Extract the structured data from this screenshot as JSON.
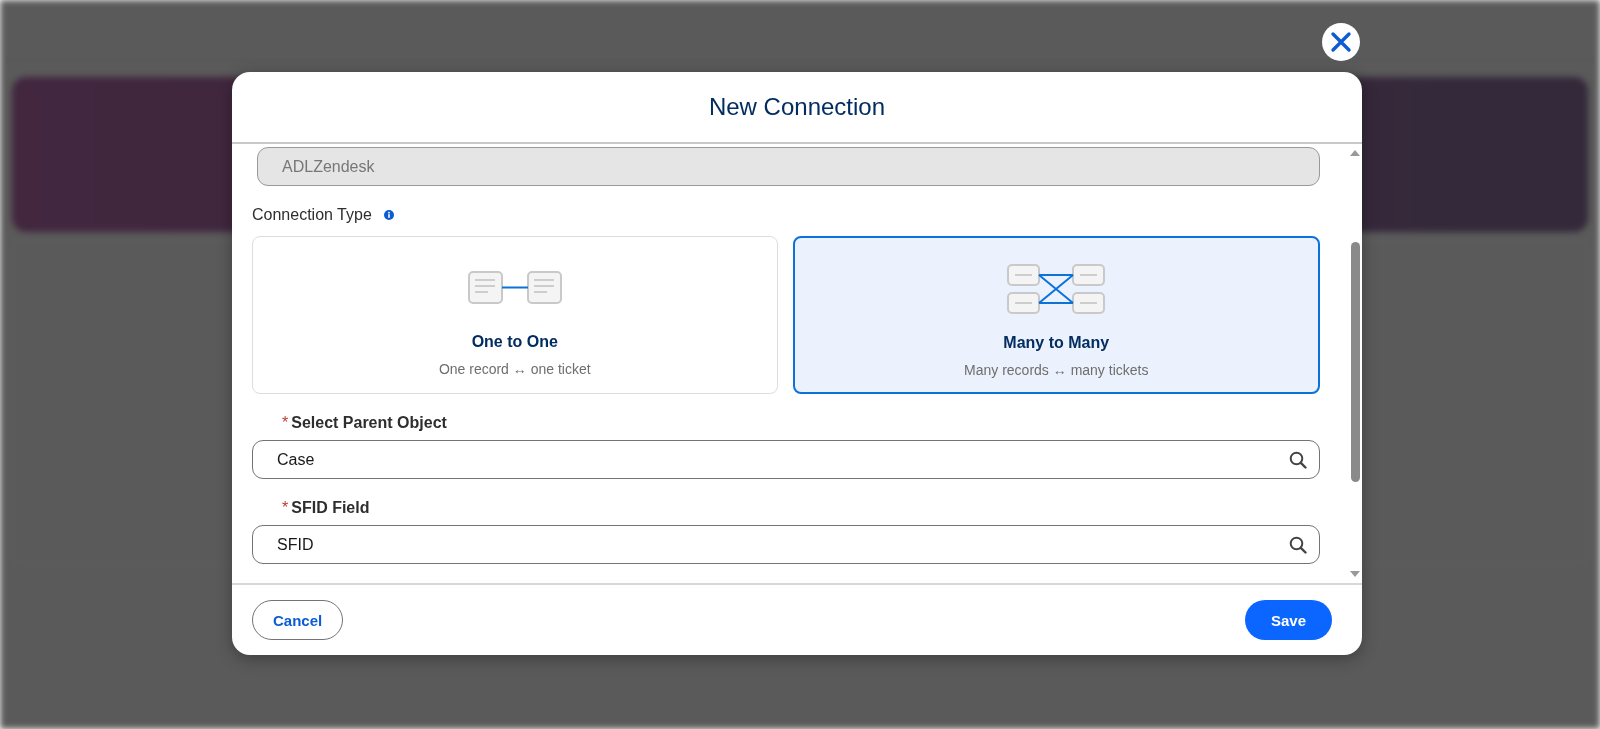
{
  "dialog": {
    "title": "New Connection",
    "name_field": {
      "value": "ADLZendesk",
      "disabled": true
    },
    "connection_type": {
      "label": "Connection Type",
      "options": [
        {
          "kind": "one",
          "title": "One to One",
          "subtitle": "One record ↔ one ticket",
          "selected": false
        },
        {
          "kind": "many",
          "title": "Many to Many",
          "subtitle": "Many records ↔ many tickets",
          "selected": true
        }
      ]
    },
    "fields": [
      {
        "label": "Select Parent Object",
        "required": true,
        "required_mark": "*",
        "value": "Case"
      },
      {
        "label": "SFID Field",
        "required": true,
        "required_mark": "*",
        "value": "SFID"
      }
    ],
    "buttons": [
      {
        "label": "Cancel",
        "kind": "neutral"
      },
      {
        "label": "Save",
        "kind": "brand"
      }
    ]
  }
}
